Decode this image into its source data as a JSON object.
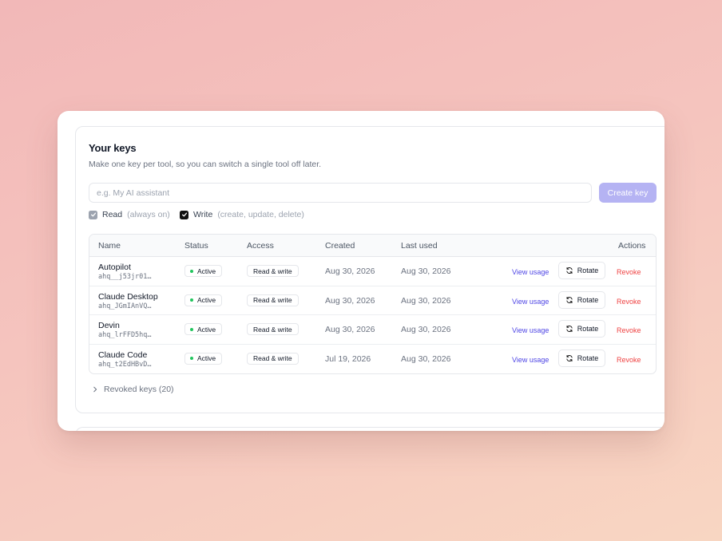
{
  "section": {
    "title": "Your keys",
    "subtitle": "Make one key per tool, so you can switch a single tool off later."
  },
  "create": {
    "placeholder": "e.g. My AI assistant",
    "value": "",
    "button_label": "Create key",
    "button_color": "#b5b3f3"
  },
  "permissions": {
    "read": {
      "label": "Read",
      "hint": "(always on)",
      "checked": true,
      "disabled": true
    },
    "write": {
      "label": "Write",
      "hint": "(create, update, delete)",
      "checked": true
    }
  },
  "table": {
    "headers": {
      "name": "Name",
      "status": "Status",
      "access": "Access",
      "created": "Created",
      "last_used": "Last used",
      "actions": "Actions"
    },
    "rows": [
      {
        "name": "Autopilot",
        "prefix": "ahq__j53jr01…",
        "status": "Active",
        "access": "Read & write",
        "created": "Aug 30, 2026",
        "last_used": "Aug 30, 2026",
        "view": "View usage",
        "rotate": "Rotate",
        "revoke": "Revoke"
      },
      {
        "name": "Claude Desktop",
        "prefix": "ahq_JGmIAnVQ…",
        "status": "Active",
        "access": "Read & write",
        "created": "Aug 30, 2026",
        "last_used": "Aug 30, 2026",
        "view": "View usage",
        "rotate": "Rotate",
        "revoke": "Revoke"
      },
      {
        "name": "Devin",
        "prefix": "ahq_lrFFD5hq…",
        "status": "Active",
        "access": "Read & write",
        "created": "Aug 30, 2026",
        "last_used": "Aug 30, 2026",
        "view": "View usage",
        "rotate": "Rotate",
        "revoke": "Revoke"
      },
      {
        "name": "Claude Code",
        "prefix": "ahq_t2EdHBvD…",
        "status": "Active",
        "access": "Read & write",
        "created": "Jul 19, 2026",
        "last_used": "Aug 30, 2026",
        "view": "View usage",
        "rotate": "Rotate",
        "revoke": "Revoke"
      }
    ]
  },
  "revoked": {
    "label": "Revoked keys (20)"
  },
  "icons": {
    "checkbox": "check-icon",
    "rotate": "refresh-icon",
    "expand": "chevron-right-icon"
  },
  "colors": {
    "active_dot": "#22c55e",
    "link": "#4f46e5",
    "danger": "#ef4444"
  }
}
